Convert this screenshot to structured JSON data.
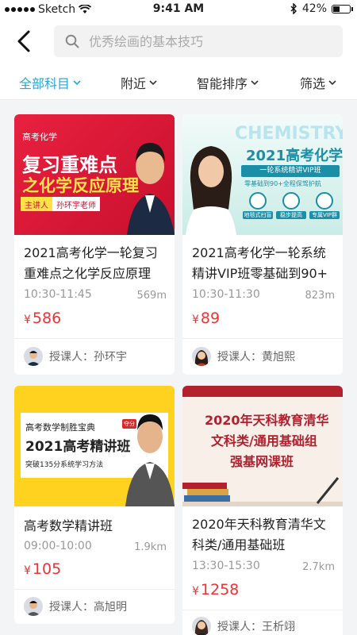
{
  "status_bar": {
    "carrier": "Sketch",
    "time": "9:41 AM",
    "battery_percent": "42%",
    "battery_level": 0.42
  },
  "search": {
    "placeholder": "优秀绘画的基本技巧"
  },
  "filters": {
    "subject": "全部科目",
    "nearby": "附近",
    "sort": "智能排序",
    "filter": "筛选"
  },
  "colors": {
    "accent": "#27a7d8",
    "price": "#e33333"
  },
  "courses": [
    {
      "title": "2021高考化学一轮复习重难点之化学反应原理",
      "time": "10:30-11:45",
      "distance": "569m",
      "currency": "¥",
      "price": "586",
      "teacher_label": "授课人：",
      "teacher": "孙环宇",
      "thumb": {
        "tag": "高考化学",
        "line1": "复习重难点",
        "line2": "之化学反应原理",
        "host_label": "主讲人",
        "host": "孙环宇老师"
      }
    },
    {
      "title": "2021高考化学一轮系统精讲VIP班零基础到90+",
      "time": "10:30-11:30",
      "distance": "823m",
      "currency": "¥",
      "price": "89",
      "teacher_label": "授课人：",
      "teacher": "黄旭熙",
      "thumb": {
        "en": "CHEMISTRY",
        "line1": "2021高考化学",
        "line2": "一轮系统精讲VIP班",
        "line3": "零基础到90+全程保驾护航",
        "badges": [
          "地毯式扫盲",
          "稳步提高",
          "专属VIP群"
        ]
      }
    },
    {
      "title": "高考数学精讲班",
      "time": "09:00-10:00",
      "distance": "1.9km",
      "currency": "¥",
      "price": "105",
      "teacher_label": "授课人：",
      "teacher": "高旭明",
      "thumb": {
        "line1": "高考数学制胜宝典",
        "seal": "夺分",
        "line2": "2021高考精讲班",
        "line3": "突破135分系统学习方法"
      }
    },
    {
      "title": "2020年天科教育清华文科类/通用基础班",
      "time": "13:30-15:30",
      "distance": "2.7km",
      "currency": "¥",
      "price": "1258",
      "teacher_label": "授课人：",
      "teacher": "王析翊",
      "thumb": {
        "line1": "2020年天科教育清华",
        "line2": "文科类/通用基础组",
        "line3": "强基网课班"
      }
    }
  ]
}
